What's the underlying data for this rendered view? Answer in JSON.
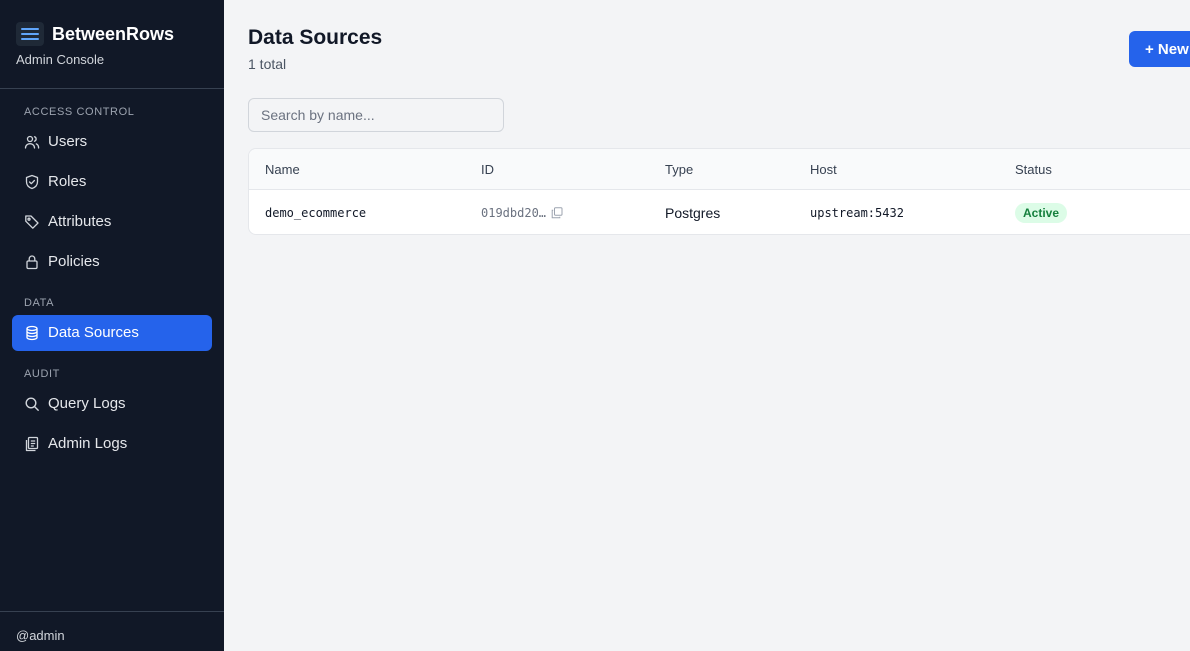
{
  "sidebar": {
    "brand_title": "BetweenRows",
    "brand_subtitle": "Admin Console",
    "sections": [
      {
        "label": "ACCESS CONTROL",
        "items": [
          {
            "label": "Users",
            "icon": "users-icon"
          },
          {
            "label": "Roles",
            "icon": "shield-icon"
          },
          {
            "label": "Attributes",
            "icon": "tag-icon"
          },
          {
            "label": "Policies",
            "icon": "lock-icon"
          }
        ]
      },
      {
        "label": "DATA",
        "items": [
          {
            "label": "Data Sources",
            "icon": "database-icon",
            "active": true
          }
        ]
      },
      {
        "label": "AUDIT",
        "items": [
          {
            "label": "Query Logs",
            "icon": "search-icon"
          },
          {
            "label": "Admin Logs",
            "icon": "clipboard-icon"
          }
        ]
      }
    ],
    "user": "@admin"
  },
  "main": {
    "title": "Data Sources",
    "count": "1 total",
    "new_button_label": "+ New",
    "search_placeholder": "Search by name...",
    "table": {
      "columns": [
        "Name",
        "ID",
        "Type",
        "Host",
        "Status"
      ],
      "rows": [
        {
          "name": "demo_ecommerce",
          "id": "019dbd20…",
          "type": "Postgres",
          "host": "upstream:5432",
          "status": "Active"
        }
      ]
    }
  },
  "colors": {
    "sidebar_bg": "#111827",
    "accent": "#2563eb",
    "page_bg": "#f3f4f6",
    "status_active_bg": "#dcfce7",
    "status_active_text": "#15803d"
  }
}
